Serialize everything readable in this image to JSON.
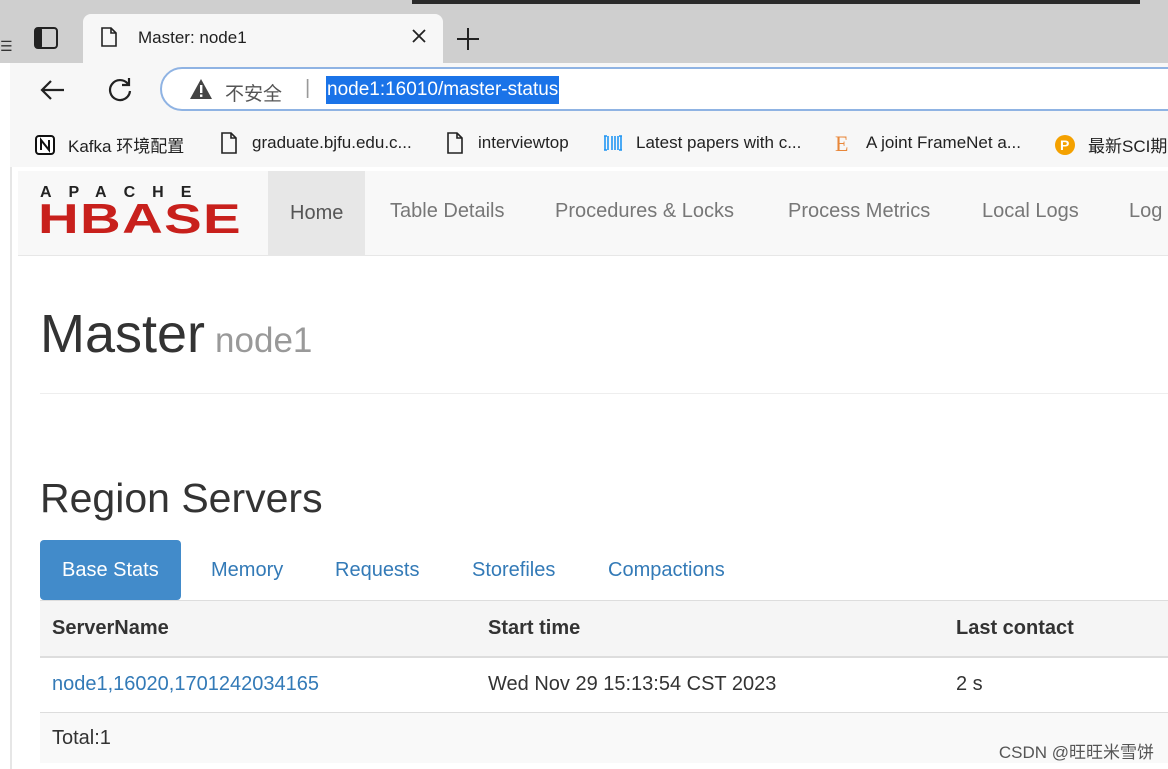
{
  "browser": {
    "tab_title": "Master: node1",
    "security_label": "不安全",
    "separator": "|",
    "url": "node1:16010/master-status",
    "bookmarks": [
      {
        "label": "Kafka 环境配置"
      },
      {
        "label": "graduate.bjfu.edu.c..."
      },
      {
        "label": "interviewtop"
      },
      {
        "label": "Latest papers with c..."
      },
      {
        "label": "A joint FrameNet a..."
      },
      {
        "label": "最新SCI期"
      }
    ]
  },
  "navbar": {
    "logo_top": "APACHE",
    "logo_main": "HBASE",
    "items": [
      "Home",
      "Table Details",
      "Procedures & Locks",
      "Process Metrics",
      "Local Logs",
      "Log"
    ]
  },
  "page": {
    "title": "Master",
    "subtitle": "node1",
    "section_title": "Region Servers"
  },
  "tabs": [
    "Base Stats",
    "Memory",
    "Requests",
    "Storefiles",
    "Compactions"
  ],
  "table": {
    "headers": [
      "ServerName",
      "Start time",
      "Last contact"
    ],
    "rows": [
      {
        "server": "node1,16020,1701242034165",
        "start": "Wed Nov 29 15:13:54 CST 2023",
        "last_contact": "2 s"
      }
    ],
    "total": "Total:1"
  },
  "watermark": "CSDN @旺旺米雪饼",
  "colors": {
    "accent": "#428bca",
    "link": "#337ab7",
    "hbase_red": "#c8201c"
  }
}
